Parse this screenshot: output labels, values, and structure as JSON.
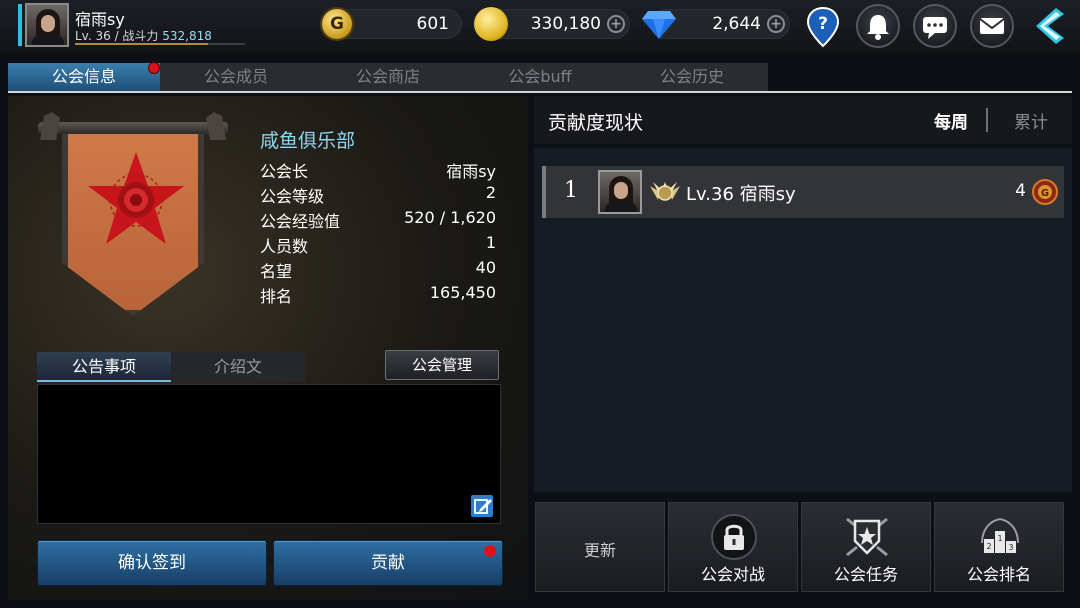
{
  "player": {
    "name": "宿雨sy",
    "level_power_prefix": "Lv. 36 / 战斗力 ",
    "power": "532,818",
    "xp_progress": 0.78
  },
  "currencies": {
    "gold": "601",
    "coins": "330,180",
    "gems": "2,644"
  },
  "tabs": [
    {
      "label": "公会信息",
      "active": true,
      "has_badge": true
    },
    {
      "label": "公会成员"
    },
    {
      "label": "公会商店"
    },
    {
      "label": "公会buff"
    },
    {
      "label": "公会历史"
    }
  ],
  "guild": {
    "name": "咸鱼俱乐部",
    "rows": [
      {
        "key": "公会长",
        "value": "宿雨sy"
      },
      {
        "key": "公会等级",
        "value": "2"
      },
      {
        "key": "公会经验值",
        "value": "520 / 1,620"
      },
      {
        "key": "人员数",
        "value": "1"
      },
      {
        "key": "名望",
        "value": "40"
      },
      {
        "key": "排名",
        "value": "165,450"
      }
    ]
  },
  "notice": {
    "tabs": [
      "公告事项",
      "介绍文"
    ],
    "manage_label": "公会管理"
  },
  "buttons": {
    "checkin": "确认签到",
    "contribute": "贡献"
  },
  "contribution": {
    "title": "贡献度现状",
    "filters": [
      "每周",
      "累计"
    ],
    "rows": [
      {
        "rank": "1",
        "name": "Lv.36 宿雨sy",
        "score": "4"
      }
    ]
  },
  "actions": {
    "refresh": "更新",
    "guild_battle": "公会对战",
    "guild_mission": "公会任务",
    "guild_ranking": "公会排名"
  },
  "colors": {
    "accent_blue": "#2f6fa3",
    "highlight_cyan": "#8fd6ef",
    "badge_red": "#d8141a",
    "banner_orange": "#cf7a48",
    "emblem_red": "#c8151b"
  },
  "icons": {
    "top_right": [
      "help-icon",
      "bell-icon",
      "chat-icon",
      "mail-icon",
      "back-arrow-icon"
    ]
  }
}
